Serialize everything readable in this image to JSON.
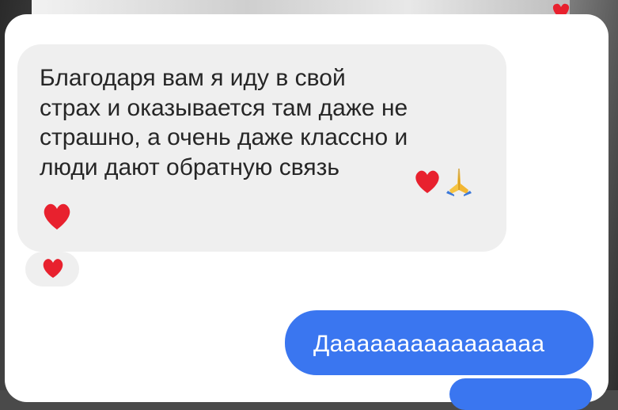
{
  "background": {
    "photo_colors": [
      "#2a2a2a",
      "#6d6d6d",
      "#8a8a8a"
    ]
  },
  "colors": {
    "incoming_bubble": "#efefef",
    "outgoing_bubble": "#3a76f0",
    "heart": "#e8212e"
  },
  "incoming_message": {
    "text": "Благодаря вам я иду в свой\nстрах и оказывается там даже не\nстрашно, а очень даже классно и\nлюди дают обратную связь",
    "emojis": [
      "heart-emoji",
      "folded-hands-emoji",
      "heart-emoji"
    ],
    "reaction": "heart-emoji"
  },
  "outgoing_message": {
    "text": "Даааааааааааааааа"
  }
}
